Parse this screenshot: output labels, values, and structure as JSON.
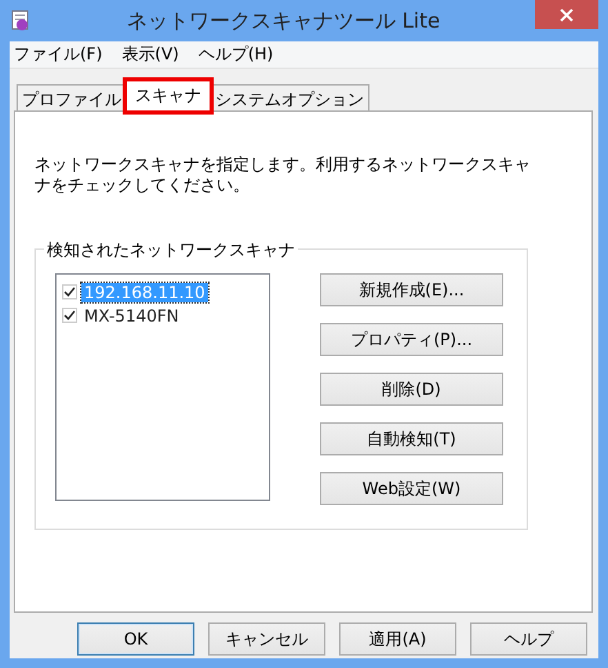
{
  "window": {
    "title": "ネットワークスキャナツール Lite"
  },
  "menu": [
    "ファイル(F)",
    "表示(V)",
    "ヘルプ(H)"
  ],
  "tabs": [
    {
      "label": "プロファイル",
      "selected": false,
      "highlighted": false
    },
    {
      "label": "スキャナ",
      "selected": true,
      "highlighted": true
    },
    {
      "label": "システムオプション",
      "selected": false,
      "highlighted": false
    }
  ],
  "description": "ネットワークスキャナを指定します。利用するネットワークスキャナをチェックしてください。",
  "group": {
    "title": "検知されたネットワークスキャナ",
    "scanners": [
      {
        "name": "192.168.11.10",
        "checked": true,
        "selected": true
      },
      {
        "name": "MX-5140FN",
        "checked": true,
        "selected": false
      }
    ],
    "buttons": [
      "新規作成(E)...",
      "プロパティ(P)...",
      "削除(D)",
      "自動検知(T)",
      "Web設定(W)"
    ]
  },
  "footer_buttons": [
    {
      "label": "OK",
      "default": true
    },
    {
      "label": "キャンセル",
      "default": false
    },
    {
      "label": "適用(A)",
      "default": false
    },
    {
      "label": "ヘルプ",
      "default": false
    }
  ]
}
